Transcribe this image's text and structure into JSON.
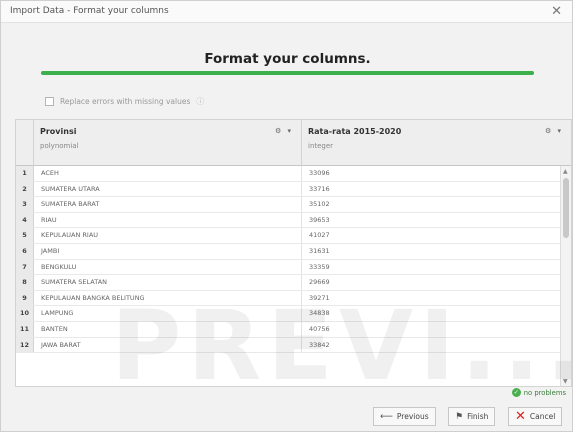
{
  "window": {
    "title": "Import Data - Format your columns",
    "close_icon": "close-icon"
  },
  "header": {
    "title": "Format your columns."
  },
  "progress": {
    "fraction": 1.0,
    "color": "#3cb04b"
  },
  "options": {
    "replace_label": "Replace errors with missing values",
    "help_icon": "question-icon"
  },
  "columns": [
    {
      "name": "Provinsi",
      "type": "polynomial",
      "controls": "⚙ ▾"
    },
    {
      "name": "Rata-rata 2015-2020",
      "type": "integer",
      "controls": "⚙ ▾"
    }
  ],
  "rows": [
    {
      "num": "1",
      "provinsi": "ACEH",
      "value": "33096"
    },
    {
      "num": "2",
      "provinsi": "SUMATERA UTARA",
      "value": "33716"
    },
    {
      "num": "3",
      "provinsi": "SUMATERA BARAT",
      "value": "35102"
    },
    {
      "num": "4",
      "provinsi": "RIAU",
      "value": "39653"
    },
    {
      "num": "5",
      "provinsi": "KEPULAUAN RIAU",
      "value": "41027"
    },
    {
      "num": "6",
      "provinsi": "JAMBI",
      "value": "31631"
    },
    {
      "num": "7",
      "provinsi": "BENGKULU",
      "value": "33359"
    },
    {
      "num": "8",
      "provinsi": "SUMATERA SELATAN",
      "value": "29669"
    },
    {
      "num": "9",
      "provinsi": "KEPULAUAN BANGKA BELITUNG",
      "value": "39271"
    },
    {
      "num": "10",
      "provinsi": "LAMPUNG",
      "value": "34838"
    },
    {
      "num": "11",
      "provinsi": "BANTEN",
      "value": "40756"
    },
    {
      "num": "12",
      "provinsi": "JAWA BARAT",
      "value": "33842"
    }
  ],
  "watermark": "PREVI...",
  "status": {
    "text": "no problems",
    "icon": "check-icon"
  },
  "buttons": {
    "previous": {
      "label": "Previous",
      "icon": "arrow-left-icon"
    },
    "finish": {
      "label": "Finish",
      "icon": "flag-icon"
    },
    "cancel": {
      "label": "Cancel",
      "icon": "x-icon"
    }
  }
}
